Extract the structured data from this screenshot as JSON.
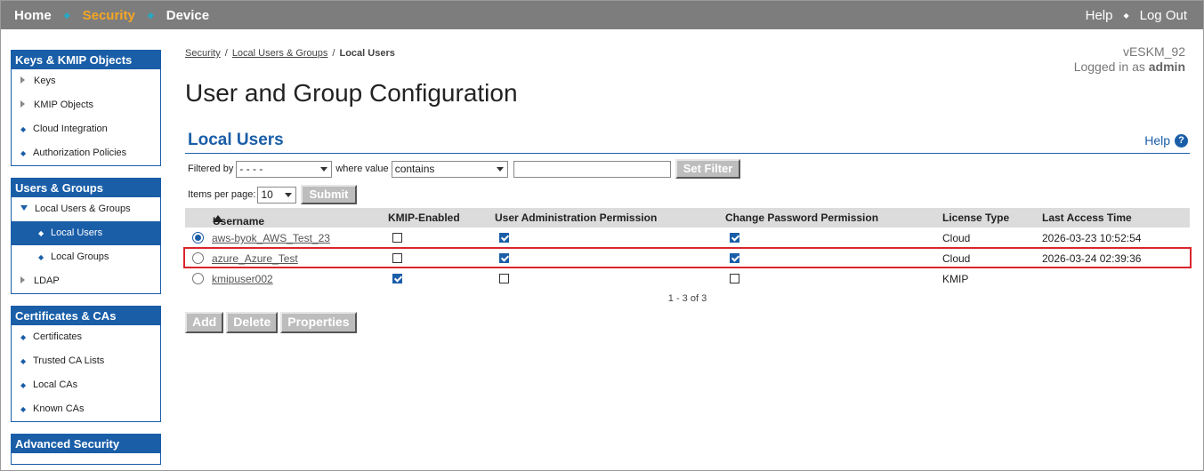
{
  "topnav": {
    "left": [
      "Home",
      "Security",
      "Device"
    ],
    "right": [
      "Help",
      "Log Out"
    ],
    "active": "Security"
  },
  "sidebar": {
    "sections": [
      {
        "title": "Keys & KMIP Objects",
        "items": [
          "Keys",
          "KMIP Objects",
          "Cloud Integration",
          "Authorization Policies"
        ]
      },
      {
        "title": "Users & Groups",
        "items": [
          "Local Users & Groups",
          "Local Users",
          "Local Groups",
          "LDAP"
        ]
      },
      {
        "title": "Certificates & CAs",
        "items": [
          "Certificates",
          "Trusted CA Lists",
          "Local CAs",
          "Known CAs"
        ]
      },
      {
        "title": "Advanced Security",
        "items": []
      }
    ],
    "selected": "Local Users"
  },
  "breadcrumb": [
    "Security",
    "Local Users & Groups",
    "Local Users"
  ],
  "device": {
    "name": "vESKM_92",
    "logged_in_prefix": "Logged in as",
    "user": "admin"
  },
  "page_title": "User and Group Configuration",
  "section": {
    "title": "Local Users",
    "help": "Help"
  },
  "filter": {
    "filtered_by_label": "Filtered by",
    "filtered_by_value": "- - - -",
    "where_value_label": "where value",
    "where_value_value": "contains",
    "text_value": "",
    "set_filter_label": "Set Filter"
  },
  "pagination": {
    "items_per_page_label": "Items per page:",
    "items_per_page_value": "10",
    "submit_label": "Submit",
    "summary": "1 - 3 of 3"
  },
  "table": {
    "columns": [
      "Username",
      "KMIP-Enabled",
      "User Administration Permission",
      "Change Password Permission",
      "License Type",
      "Last Access Time"
    ],
    "rows": [
      {
        "username": "aws-byok_AWS_Test_23",
        "kmip": false,
        "user_admin": true,
        "change_pw": true,
        "license": "Cloud",
        "last_access": "2026-03-23 10:52:54",
        "selected": true
      },
      {
        "username": "azure_Azure_Test",
        "kmip": false,
        "user_admin": true,
        "change_pw": true,
        "license": "Cloud",
        "last_access": "2026-03-24 02:39:36",
        "selected": false,
        "highlighted": true
      },
      {
        "username": "kmipuser002",
        "kmip": true,
        "user_admin": false,
        "change_pw": false,
        "license": "KMIP",
        "last_access": "",
        "selected": false
      }
    ]
  },
  "actions": [
    "Add",
    "Delete",
    "Properties"
  ],
  "colors": {
    "topbar": "#7d7d7d",
    "accent": "#1a5ea8",
    "active_nav": "#f5a623",
    "highlight": "#d9252c"
  }
}
